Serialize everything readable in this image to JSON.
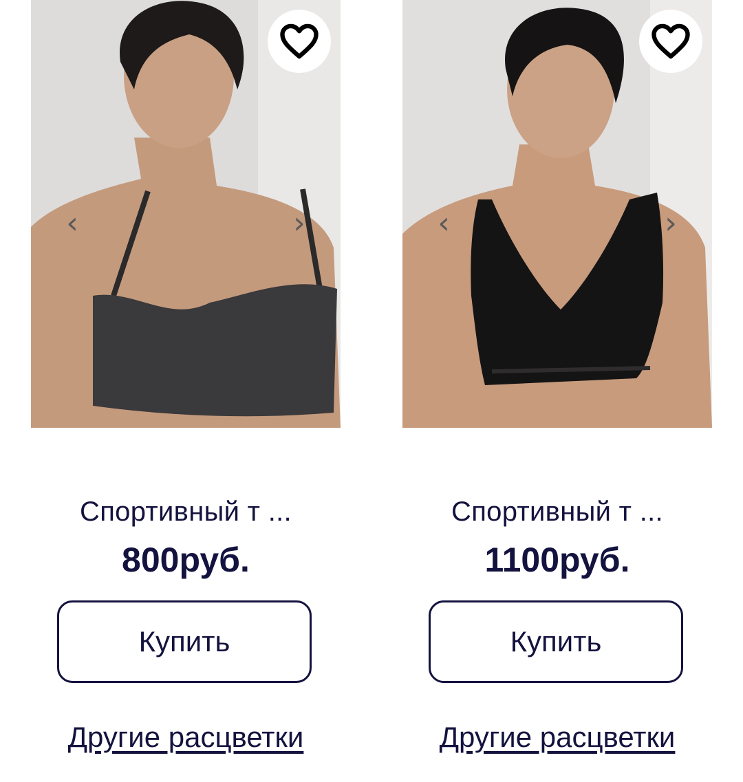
{
  "products": [
    {
      "name": "Спортивный т ...",
      "price": "800руб.",
      "buy_label": "Купить",
      "other_colors_label": "Другие расцветки",
      "prev_glyph": "‹",
      "next_glyph": "›",
      "favorite_icon": "heart-icon"
    },
    {
      "name": "Спортивный т ...",
      "price": "1100руб.",
      "buy_label": "Купить",
      "other_colors_label": "Другие расцветки",
      "prev_glyph": "‹",
      "next_glyph": "›",
      "favorite_icon": "heart-icon"
    }
  ],
  "colors": {
    "text": "#14133f",
    "button_border": "#14133f",
    "background": "#ffffff"
  }
}
